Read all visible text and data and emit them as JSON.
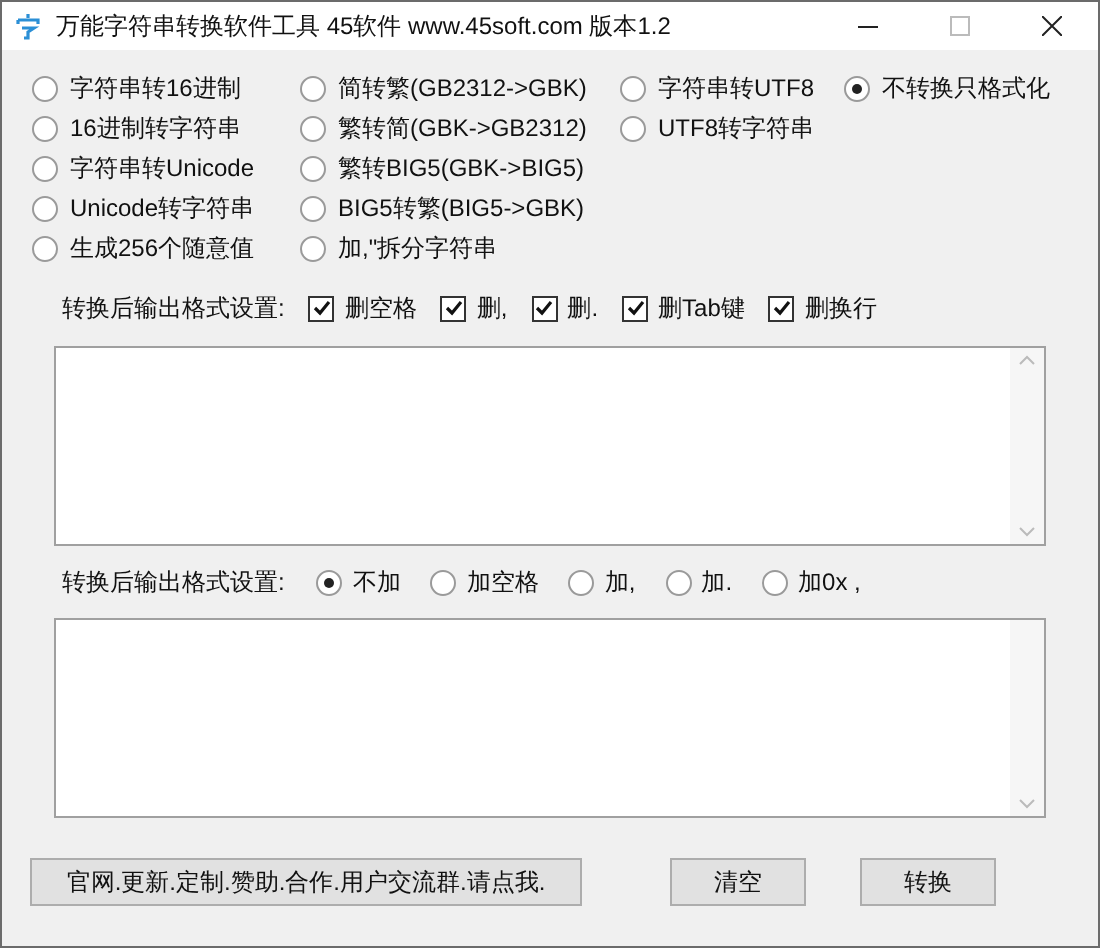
{
  "window": {
    "title": "万能字符串转换软件工具 45软件 www.45soft.com 版本1.2"
  },
  "conversion_columns": [
    [
      {
        "label": "字符串转16进制",
        "selected": false
      },
      {
        "label": "16进制转字符串",
        "selected": false
      },
      {
        "label": "字符串转Unicode",
        "selected": false
      },
      {
        "label": "Unicode转字符串",
        "selected": false
      },
      {
        "label": "生成256个随意值",
        "selected": false
      }
    ],
    [
      {
        "label": "简转繁(GB2312->GBK)",
        "selected": false
      },
      {
        "label": "繁转简(GBK->GB2312)",
        "selected": false
      },
      {
        "label": "繁转BIG5(GBK->BIG5)",
        "selected": false
      },
      {
        "label": "BIG5转繁(BIG5->GBK)",
        "selected": false
      },
      {
        "label": "加,\"拆分字符串",
        "selected": false
      }
    ],
    [
      {
        "label": "字符串转UTF8",
        "selected": false
      },
      {
        "label": "UTF8转字符串",
        "selected": false
      }
    ],
    [
      {
        "label": "不转换只格式化",
        "selected": true
      }
    ]
  ],
  "input_format": {
    "label": "转换后输出格式设置:",
    "options": [
      {
        "label": "删空格",
        "checked": true
      },
      {
        "label": "删,",
        "checked": true
      },
      {
        "label": "删.",
        "checked": true
      },
      {
        "label": "删Tab键",
        "checked": true
      },
      {
        "label": "删换行",
        "checked": true
      }
    ]
  },
  "output_format": {
    "label": "转换后输出格式设置:",
    "options": [
      {
        "label": "不加",
        "selected": true
      },
      {
        "label": "加空格",
        "selected": false
      },
      {
        "label": "加,",
        "selected": false
      },
      {
        "label": "加.",
        "selected": false
      },
      {
        "label": "加0x ,",
        "selected": false
      }
    ]
  },
  "buttons": [
    "官网.更新.定制.赞助.合作.用户交流群.请点我.",
    "清空",
    "转换"
  ]
}
